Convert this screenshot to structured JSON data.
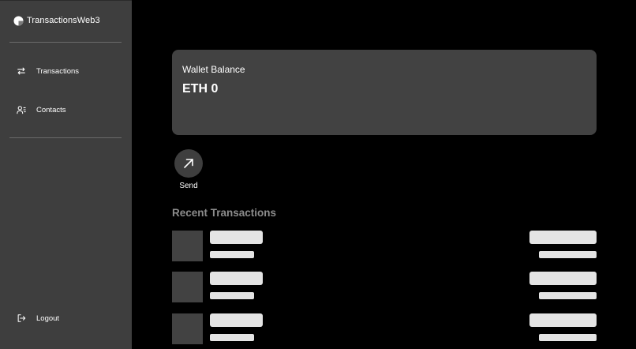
{
  "app": {
    "name": "TransactionsWeb3",
    "logo_icon": "half-circle-logo-icon"
  },
  "sidebar": {
    "items": [
      {
        "label": "Transactions",
        "icon": "swap-arrows-icon"
      },
      {
        "label": "Contacts",
        "icon": "contacts-list-icon"
      }
    ],
    "logout": {
      "label": "Logout",
      "icon": "logout-icon"
    }
  },
  "wallet": {
    "title": "Wallet Balance",
    "value": "ETH 0"
  },
  "actions": {
    "send_label": "Send",
    "send_icon": "arrow-up-right-icon"
  },
  "recent": {
    "title": "Recent Transactions",
    "rows_loading": 3
  },
  "colors": {
    "page_bg": "#000000",
    "sidebar_bg": "#3e3e3e",
    "card_bg": "#424242",
    "skeleton": "#e4e4e4",
    "muted_heading": "#8c8c8c"
  }
}
